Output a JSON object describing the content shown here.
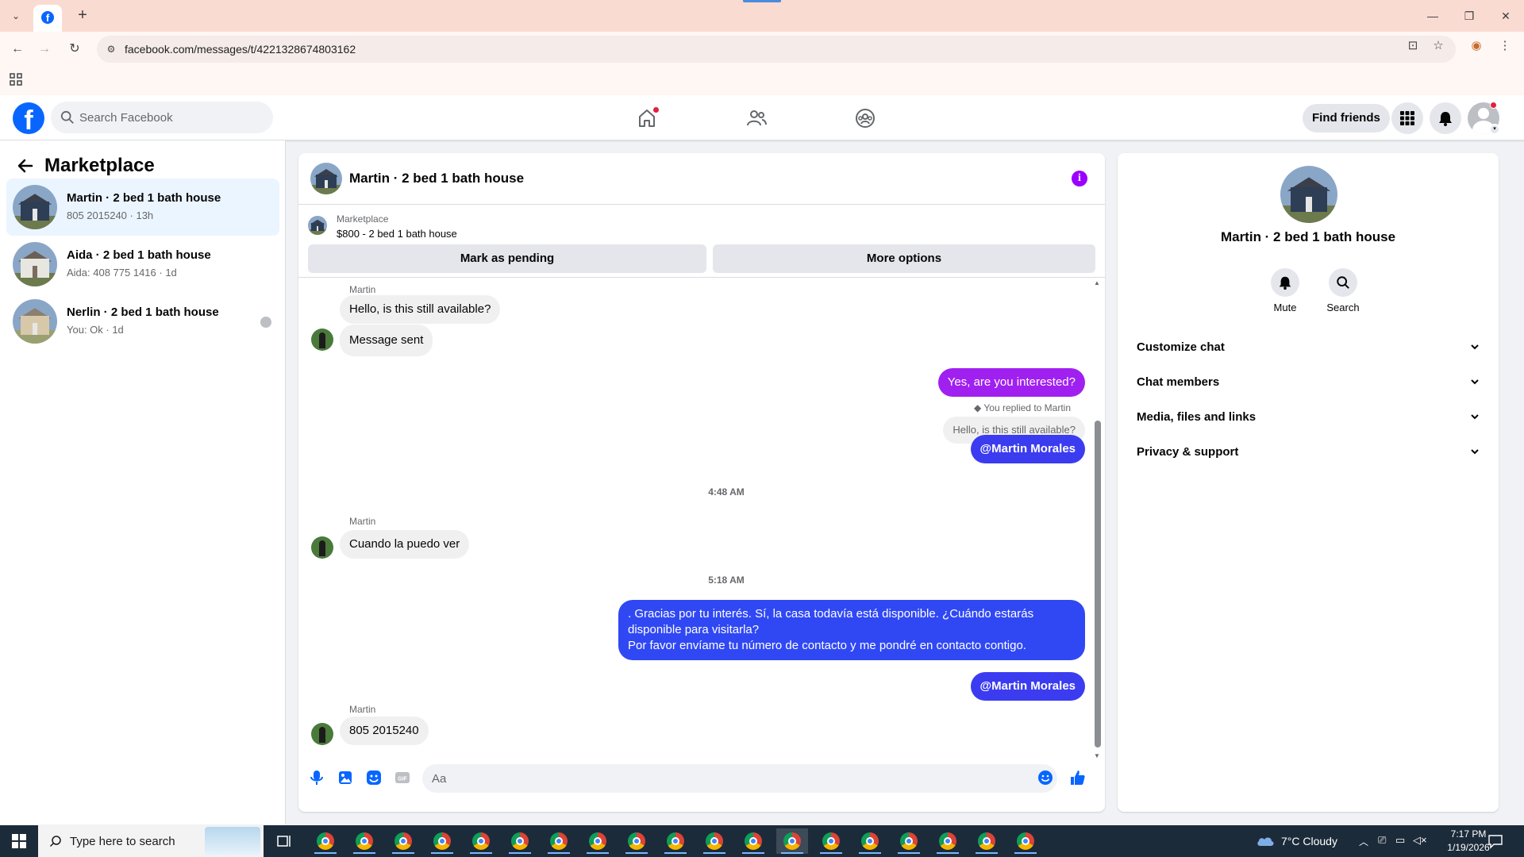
{
  "browser": {
    "url": "facebook.com/messages/t/4221328674803162",
    "tab_icon": "facebook-icon"
  },
  "fb_header": {
    "logo": "f",
    "search_placeholder": "Search Facebook",
    "find_friends": "Find friends"
  },
  "sidebar": {
    "title": "Marketplace",
    "conversations": [
      {
        "name": "Martin · 2 bed 1 bath house",
        "preview": "805 2015240 · 13h",
        "active": true
      },
      {
        "name": "Aida · 2 bed 1 bath house",
        "preview": "Aida: 408 775 1416 · 1d",
        "active": false
      },
      {
        "name": "Nerlin · 2 bed 1 bath house",
        "preview": "You: Ok · 1d",
        "active": false
      }
    ]
  },
  "chat": {
    "title": "Martin · 2 bed 1 bath house",
    "listing": {
      "source": "Marketplace",
      "description": "$800 - 2 bed 1 bath house"
    },
    "buttons": {
      "mark_pending": "Mark as pending",
      "more_options": "More options"
    },
    "messages": {
      "sender1": "Martin",
      "m1": "Hello, is this still available?",
      "m2": "Message sent",
      "m3": "Yes, are you interested?",
      "reply_note": "You replied to Martin",
      "reply_quote": "Hello, is this still available?",
      "m4": "@Martin Morales",
      "time1": "4:48 AM",
      "sender2": "Martin",
      "m5": "Cuando la puedo ver",
      "time2": "5:18 AM",
      "m6_line1": ". Gracias por tu interés. Sí, la casa todavía está disponible. ¿Cuándo estarás disponible para visitarla?",
      "m6_line2": "Por favor envíame tu número de contacto y me pondré en contacto contigo.",
      "m7": "@Martin Morales",
      "sender3": "Martin",
      "m8": "805 2015240"
    },
    "composer_placeholder": "Aa"
  },
  "info_panel": {
    "name": "Martin · 2 bed 1 bath house",
    "actions": {
      "mute": "Mute",
      "search": "Search"
    },
    "sections": [
      "Customize chat",
      "Chat members",
      "Media, files and links",
      "Privacy & support"
    ]
  },
  "taskbar": {
    "search_placeholder": "Type here to search",
    "weather": "7°C  Cloudy",
    "time": "7:17 PM",
    "date": "1/19/2026"
  },
  "colors": {
    "fb_blue": "#0866ff",
    "outgoing_purple": "#a020f0",
    "outgoing_indigo": "#3b3cf0",
    "outgoing_blue": "#3048f4"
  }
}
